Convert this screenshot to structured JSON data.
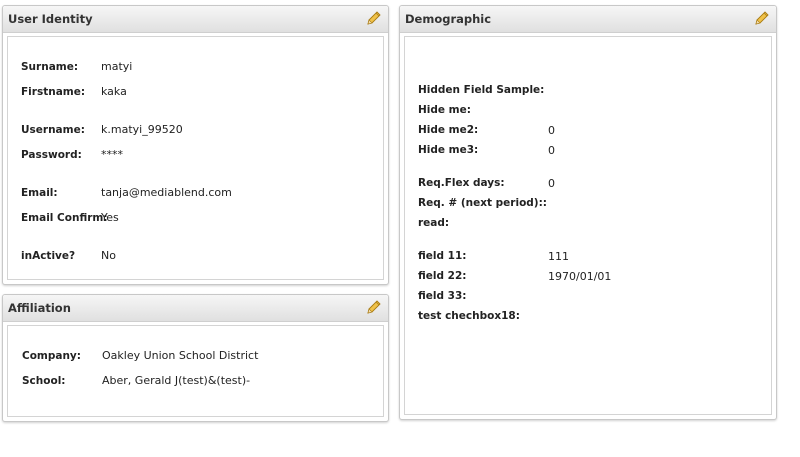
{
  "user_identity": {
    "title": "User Identity",
    "fields": [
      {
        "label": "Surname:",
        "value": "matyi"
      },
      {
        "label": "Firstname:",
        "value": "kaka"
      },
      {
        "label": "Username:",
        "value": "k.matyi_99520"
      },
      {
        "label": "Password:",
        "value": "****"
      },
      {
        "label": "Email:",
        "value": "tanja@mediablend.com"
      },
      {
        "label": "Email Confirm:",
        "value": "Yes"
      },
      {
        "label": "inActive?",
        "value": "No"
      }
    ]
  },
  "affiliation": {
    "title": "Affiliation",
    "fields": [
      {
        "label": "Company:",
        "value": "Oakley Union School District"
      },
      {
        "label": "School:",
        "value": "Aber, Gerald J(test)&(test)-"
      }
    ]
  },
  "demographic": {
    "title": "Demographic",
    "fields": [
      {
        "label": "Hidden Field Sample:",
        "value": ""
      },
      {
        "label": "Hide me:",
        "value": ""
      },
      {
        "label": "Hide me2:",
        "value": "0"
      },
      {
        "label": "Hide me3:",
        "value": "0"
      },
      {
        "label": "Req.Flex days:",
        "value": "0"
      },
      {
        "label": "Req. # (next period)::",
        "value": ""
      },
      {
        "label": "read:",
        "value": ""
      },
      {
        "label": "field 11:",
        "value": "111"
      },
      {
        "label": "field 22:",
        "value": "1970/01/01"
      },
      {
        "label": "field 33:",
        "value": ""
      },
      {
        "label": "test chechbox18:",
        "value": ""
      }
    ]
  },
  "icons": {
    "edit": "pencil-edit-icon"
  },
  "colors": {
    "header_top": "#f6f6f6",
    "header_bottom": "#e0e0e0",
    "pencil": "#e3b23c"
  }
}
